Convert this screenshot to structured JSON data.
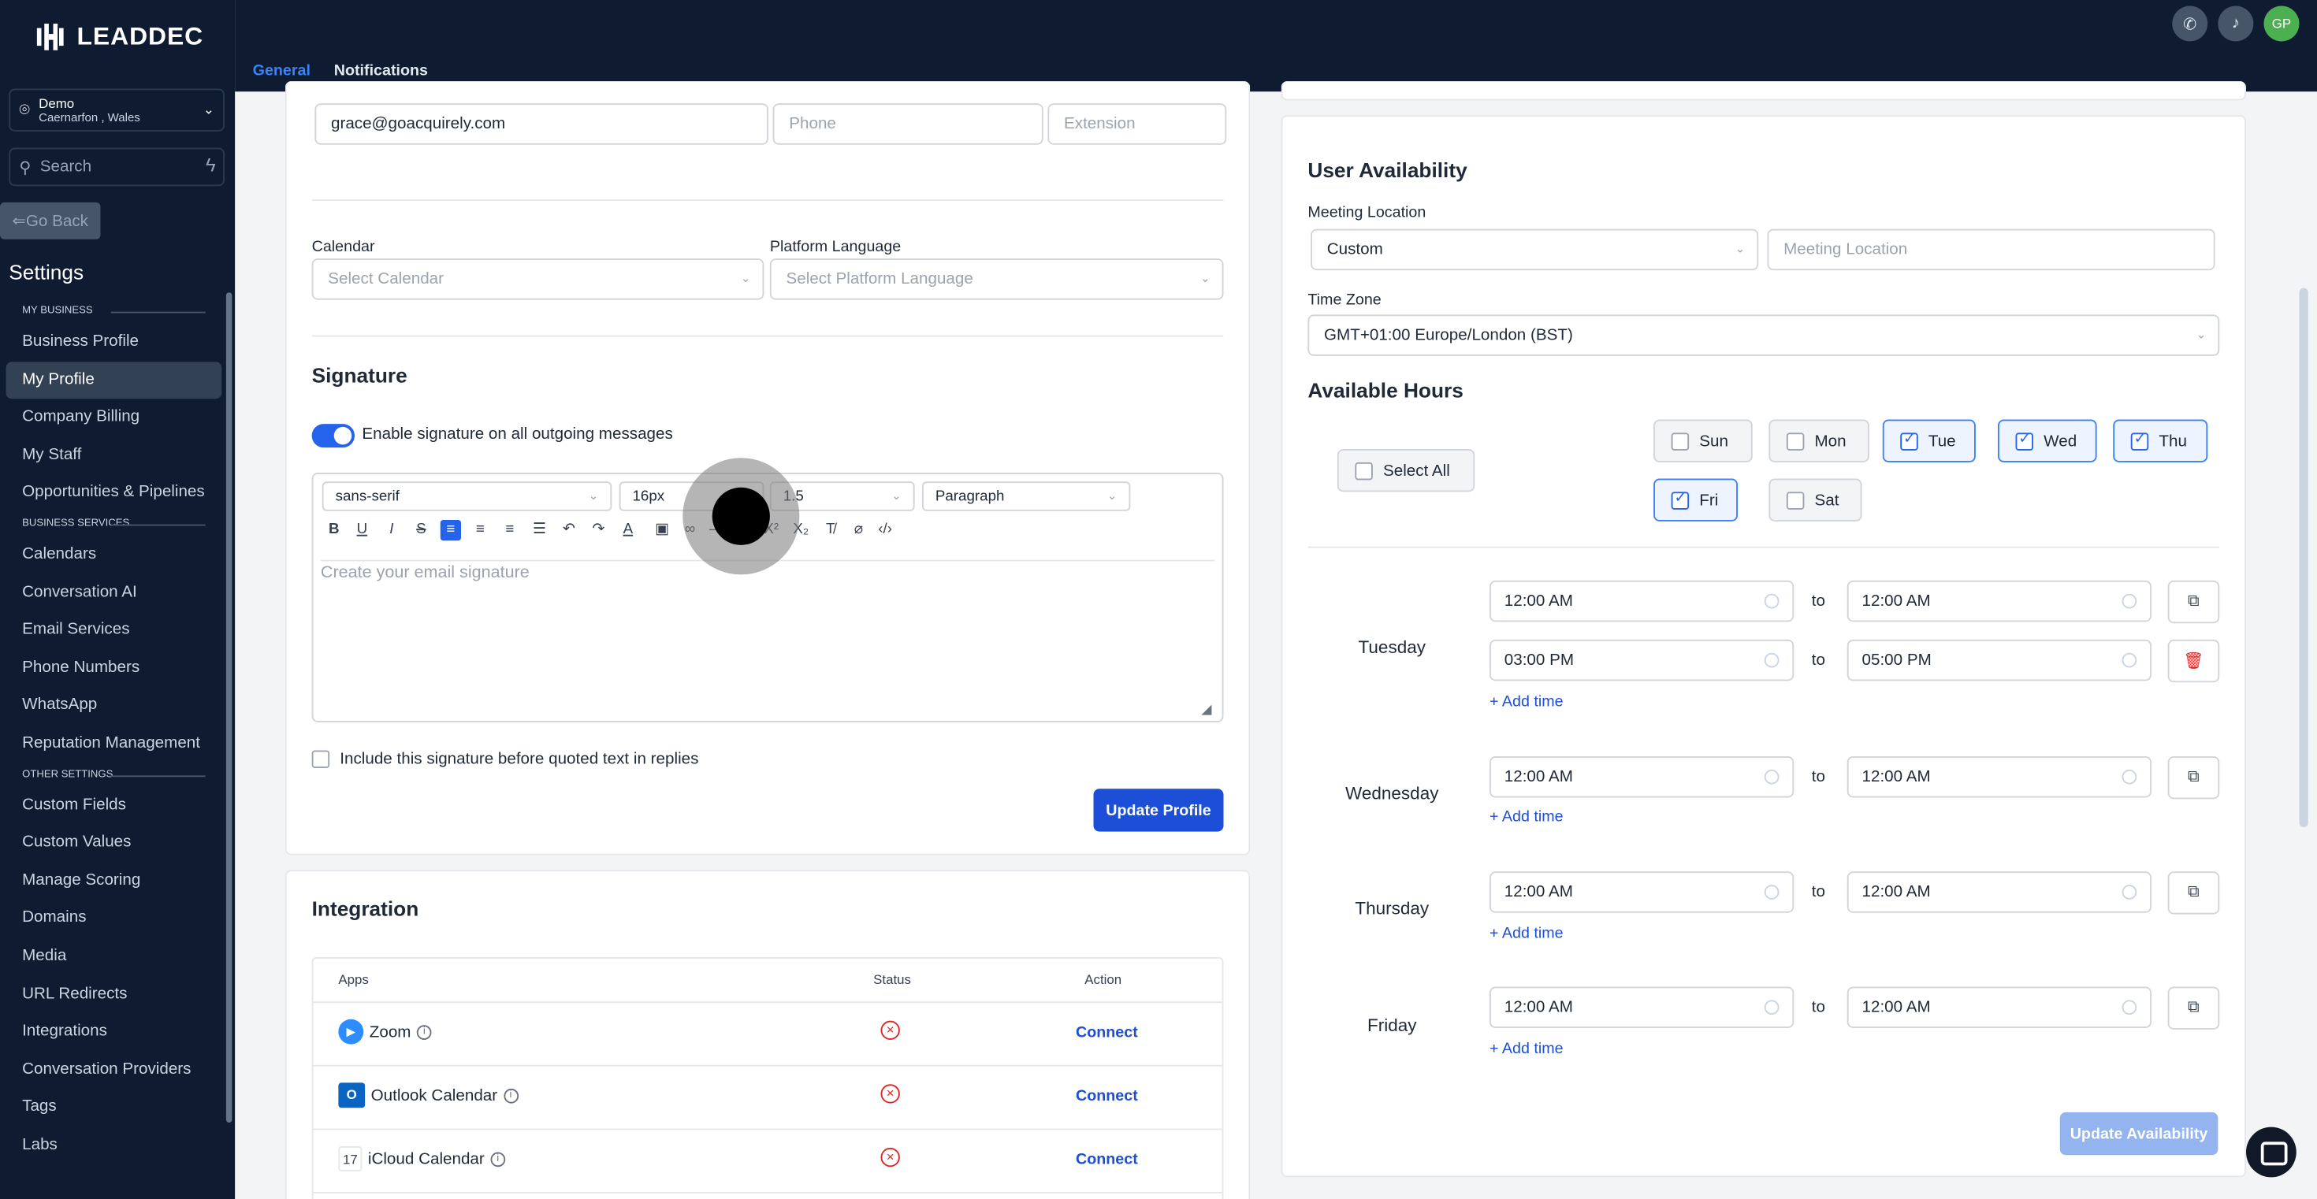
{
  "sidebar": {
    "logo_text": "LEADDEC",
    "location": {
      "name": "Demo",
      "sub": "Caernarfon , Wales"
    },
    "search_placeholder": "Search",
    "go_back": "Go Back",
    "settings_title": "Settings",
    "sections": [
      {
        "title": "MY BUSINESS",
        "items": [
          "Business Profile",
          "My Profile",
          "Company Billing",
          "My Staff",
          "Opportunities & Pipelines"
        ]
      },
      {
        "title": "BUSINESS SERVICES",
        "items": [
          "Calendars",
          "Conversation AI",
          "Email Services",
          "Phone Numbers",
          "WhatsApp",
          "Reputation Management"
        ]
      },
      {
        "title": "OTHER SETTINGS",
        "items": [
          "Custom Fields",
          "Custom Values",
          "Manage Scoring",
          "Domains",
          "Media",
          "URL Redirects",
          "Integrations",
          "Conversation Providers",
          "Tags",
          "Labs"
        ]
      }
    ],
    "active_item": "My Profile"
  },
  "topbar": {
    "tabs": [
      "General",
      "Notifications"
    ],
    "avatar": "GP"
  },
  "profile": {
    "email": "grace@goacquirely.com",
    "phone_placeholder": "Phone",
    "extension_placeholder": "Extension",
    "calendar_label": "Calendar",
    "calendar_placeholder": "Select Calendar",
    "language_label": "Platform Language",
    "language_placeholder": "Select Platform Language",
    "signature_title": "Signature",
    "signature_toggle_label": "Enable signature on all outgoing messages",
    "editor": {
      "font": "sans-serif",
      "size": "16px",
      "line_height": "1.5",
      "block": "Paragraph",
      "placeholder": "Create your email signature"
    },
    "include_label": "Include this signature before quoted text in replies",
    "update_button": "Update Profile"
  },
  "integration": {
    "title": "Integration",
    "headers": [
      "Apps",
      "Status",
      "Action"
    ],
    "rows": [
      {
        "app": "Zoom",
        "action": "Connect"
      },
      {
        "app": "Outlook Calendar",
        "action": "Connect"
      },
      {
        "app": "iCloud Calendar",
        "action": "Connect"
      }
    ]
  },
  "availability": {
    "title": "User Availability",
    "meeting_location_label": "Meeting Location",
    "meeting_location_value": "Custom",
    "meeting_location_placeholder": "Meeting Location",
    "timezone_label": "Time Zone",
    "timezone_value": "GMT+01:00 Europe/London (BST)",
    "hours_title": "Available Hours",
    "select_all": "Select All",
    "days": [
      {
        "label": "Sun",
        "checked": false
      },
      {
        "label": "Mon",
        "checked": false
      },
      {
        "label": "Tue",
        "checked": true
      },
      {
        "label": "Wed",
        "checked": true
      },
      {
        "label": "Thu",
        "checked": true
      },
      {
        "label": "Fri",
        "checked": true
      },
      {
        "label": "Sat",
        "checked": false
      }
    ],
    "to_label": "to",
    "add_time": "+ Add time",
    "schedule": [
      {
        "day": "Tuesday",
        "slots": [
          [
            "12:00 AM",
            "12:00 AM"
          ],
          [
            "03:00 PM",
            "05:00 PM"
          ]
        ]
      },
      {
        "day": "Wednesday",
        "slots": [
          [
            "12:00 AM",
            "12:00 AM"
          ]
        ]
      },
      {
        "day": "Thursday",
        "slots": [
          [
            "12:00 AM",
            "12:00 AM"
          ]
        ]
      },
      {
        "day": "Friday",
        "slots": [
          [
            "12:00 AM",
            "12:00 AM"
          ]
        ]
      }
    ],
    "update_button": "Update Availability"
  }
}
